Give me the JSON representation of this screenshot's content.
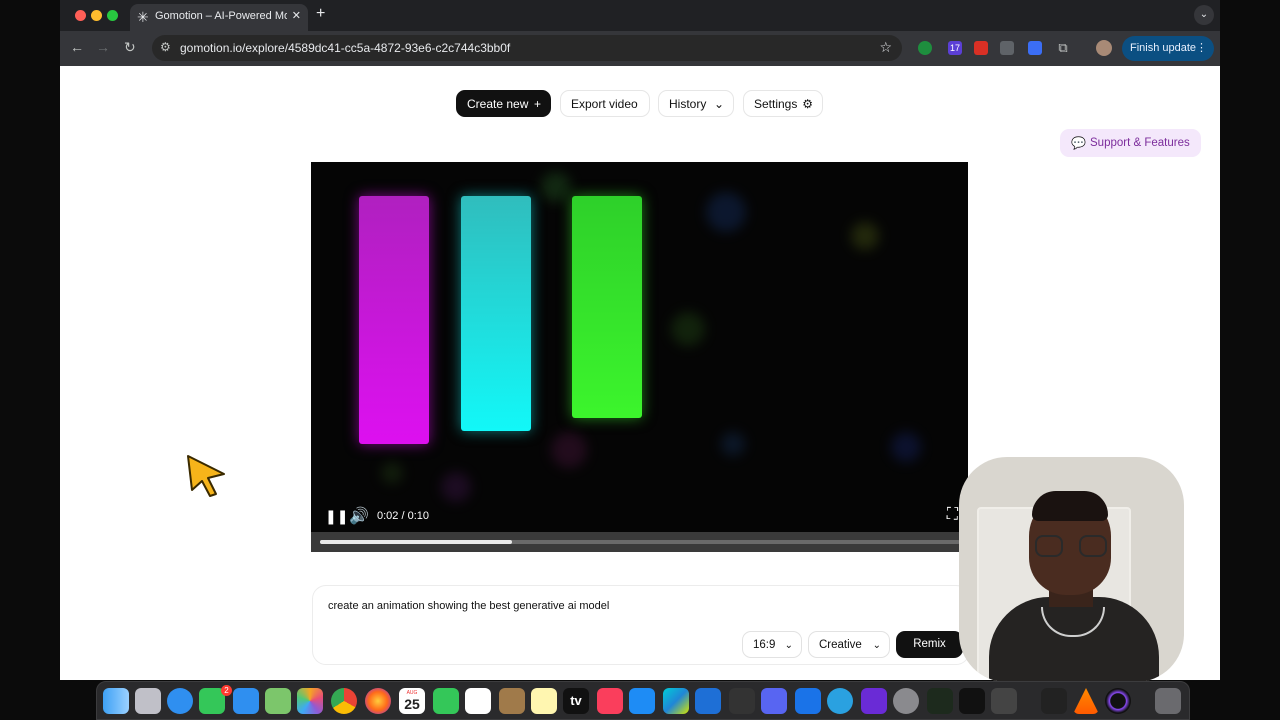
{
  "browser": {
    "tab_title": "Gomotion – AI-Powered Moti",
    "url": "gomotion.io/explore/4589dc41-cc5a-4872-93e6-c2c744c3bb0f",
    "finish_update_label": "Finish update",
    "ext_badge": "17"
  },
  "toolbar": {
    "create_label": "Create new",
    "export_label": "Export video",
    "history_label": "History",
    "settings_label": "Settings"
  },
  "support": {
    "label": "Support & Features"
  },
  "player": {
    "time": "0:02 / 0:10",
    "progress": 0.3,
    "bars": [
      {
        "name": "magenta",
        "color": "#e010f0"
      },
      {
        "name": "cyan",
        "color": "#10f5f5"
      },
      {
        "name": "green",
        "color": "#3cf52c"
      }
    ]
  },
  "prompt": {
    "text": "create an animation showing the best generative ai model",
    "ratio_label": "16:9",
    "mode_label": "Creative",
    "remix_label": "Remix"
  },
  "dock": {
    "messages_badge": "2",
    "calendar_month": "AUG",
    "calendar_day": "25",
    "apps": [
      "finder",
      "launchpad",
      "safari",
      "messages",
      "mail",
      "maps",
      "photos",
      "chrome",
      "firefox",
      "calendar",
      "facetime",
      "reminders",
      "contacts",
      "notes",
      "appletv",
      "music",
      "appstore",
      "webstorm",
      "vscode",
      "box",
      "discord",
      "xcode",
      "telegram",
      "tv-app",
      "settings",
      "activity-monitor",
      "terminal",
      "screen-app",
      "unity",
      "vlc",
      "orb",
      "trash"
    ],
    "appletv_label": "tv"
  },
  "colors": {
    "accent_dark": "#111111",
    "support_bg": "#f4e8fb",
    "support_fg": "#7c2d9c",
    "finish_update_bg": "#0b4f82"
  }
}
